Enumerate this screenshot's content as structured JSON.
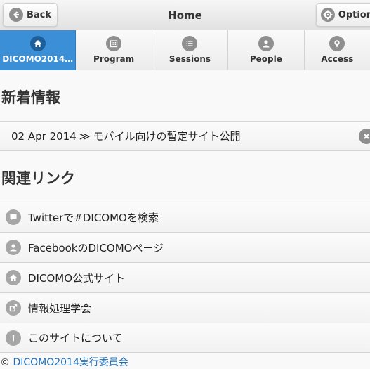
{
  "header": {
    "title": "Home",
    "back_label": "Back",
    "option_label": "Option"
  },
  "navbar": {
    "items": [
      {
        "label": "DICOMO2014…",
        "icon": "home-icon",
        "active": true
      },
      {
        "label": "Program",
        "icon": "calendar-icon"
      },
      {
        "label": "Sessions",
        "icon": "list-icon"
      },
      {
        "label": "People",
        "icon": "person-icon"
      },
      {
        "label": "Access",
        "icon": "map-pin-icon"
      }
    ]
  },
  "news": {
    "title": "新着情報",
    "items": [
      {
        "date": "02 Apr 2014",
        "sep": "≫",
        "text": "モバイル向けの暫定サイト公開"
      }
    ]
  },
  "links": {
    "title": "関連リンク",
    "items": [
      {
        "label": "Twitterで#DICOMOを検索",
        "icon": "chat-bubble-icon"
      },
      {
        "label": "FacebookのDICOMOページ",
        "icon": "person-icon"
      },
      {
        "label": "DICOMO公式サイト",
        "icon": "home-icon"
      },
      {
        "label": "情報処理学会",
        "icon": "external-link-icon"
      },
      {
        "label": "このサイトについて",
        "icon": "info-icon"
      }
    ]
  },
  "footer": {
    "copyright": "©",
    "link_text": "DICOMO2014実行委員会"
  },
  "colors": {
    "accent": "#3a8fd6",
    "icon_gray": "#8f8f8f"
  }
}
